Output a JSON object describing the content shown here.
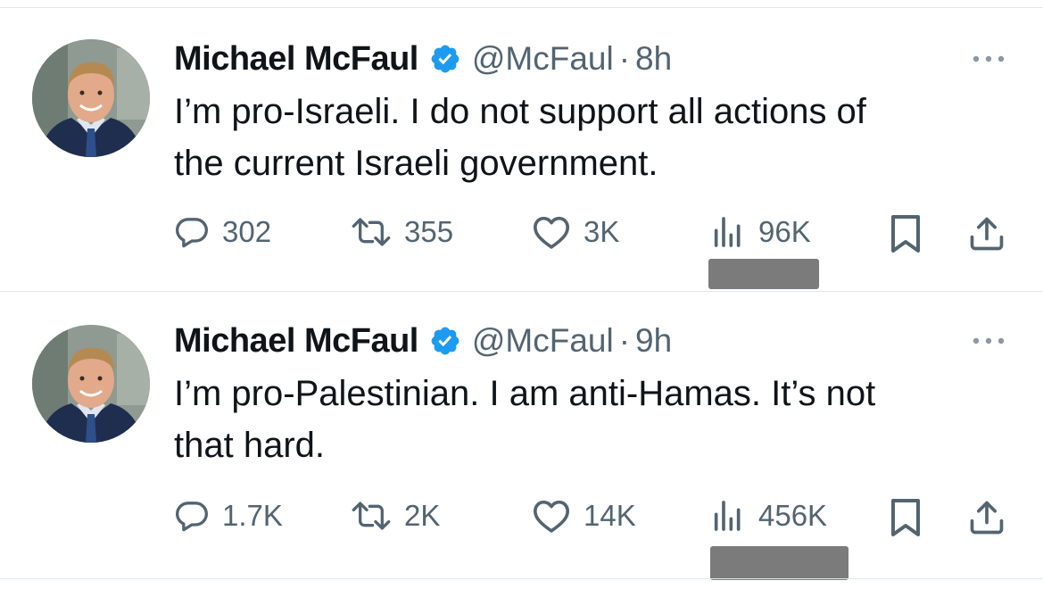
{
  "tweets": [
    {
      "author": "Michael McFaul",
      "handle": "@McFaul",
      "separator": "·",
      "time": "8h",
      "text_line1": "I’m pro-Israeli. I do not support all actions of",
      "text_line2": "the current Israeli government.",
      "replies": "302",
      "retweets": "355",
      "likes": "3K",
      "views": "96K"
    },
    {
      "author": "Michael McFaul",
      "handle": "@McFaul",
      "separator": "·",
      "time": "9h",
      "text_line1": "I’m pro-Palestinian. I am anti-Hamas. It’s not",
      "text_line2": "that hard.",
      "replies": "1.7K",
      "retweets": "2K",
      "likes": "14K",
      "views": "456K"
    }
  ],
  "colors": {
    "verified": "#1d9bf0",
    "secondary_text": "#536471",
    "divider": "#e1e6ea",
    "redaction": "#7b7b7b"
  },
  "icons": [
    "verified-badge-icon",
    "more-icon",
    "reply-icon",
    "retweet-icon",
    "like-icon",
    "views-icon",
    "bookmark-icon",
    "share-icon"
  ]
}
